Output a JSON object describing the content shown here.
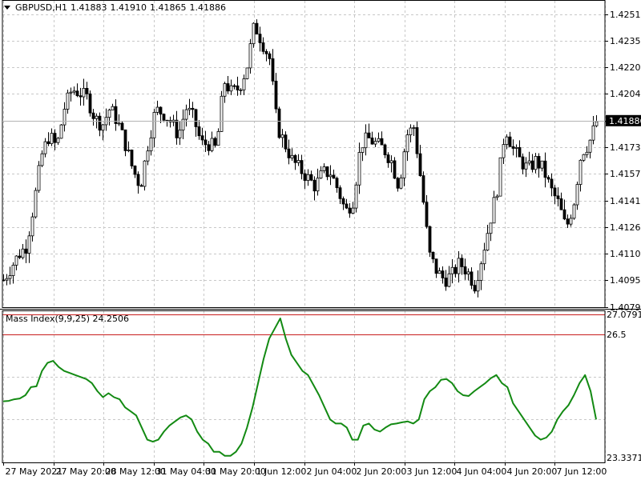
{
  "header": {
    "symbol": "GBPUSD,H1",
    "ohlc": [
      "1.41883",
      "1.41910",
      "1.41865",
      "1.41886"
    ]
  },
  "indicator": {
    "label": "Mass Index(9,9,25) 24.2506"
  },
  "colors": {
    "background": "#ffffff",
    "grid": "#c8c8c8",
    "candle": "#000000",
    "mass_index_line": "#138a13",
    "level_line": "#c81e1e",
    "price_marker": "#000000"
  },
  "chart_data": [
    {
      "type": "candlestick",
      "symbol": "GBPUSD,H1",
      "ylim": [
        1.4079,
        1.4259
      ],
      "y_ticks": [
        "1.42510",
        "1.42355",
        "1.42200",
        "1.42045",
        "1.41885",
        "1.41730",
        "1.41575",
        "1.41415",
        "1.41260",
        "1.41105",
        "1.40950",
        "1.40790"
      ],
      "current_price": "1.41886",
      "x_ticks": [
        "27 May 2021",
        "27 May 20:00",
        "28 May 12:00",
        "31 May 04:00",
        "31 May 20:00",
        "1 Jun 12:00",
        "2 Jun 04:00",
        "2 Jun 20:00",
        "3 Jun 12:00",
        "4 Jun 04:00",
        "4 Jun 20:00",
        "7 Jun 12:00"
      ],
      "close_path": [
        [
          0,
          1.4095
        ],
        [
          2,
          1.411
        ],
        [
          3,
          1.4115
        ],
        [
          4,
          1.414
        ],
        [
          5,
          1.4168
        ],
        [
          6,
          1.418
        ],
        [
          7,
          1.4173
        ],
        [
          8,
          1.4196
        ],
        [
          9,
          1.4207
        ],
        [
          10,
          1.4205
        ],
        [
          11,
          1.4202
        ],
        [
          12,
          1.419
        ],
        [
          13,
          1.4186
        ],
        [
          14,
          1.4196
        ],
        [
          15,
          1.4188
        ],
        [
          16,
          1.4175
        ],
        [
          17,
          1.416
        ],
        [
          18,
          1.415
        ],
        [
          19,
          1.4175
        ],
        [
          20,
          1.4195
        ],
        [
          21,
          1.4193
        ],
        [
          22,
          1.4188
        ],
        [
          23,
          1.418
        ],
        [
          24,
          1.4196
        ],
        [
          25,
          1.419
        ],
        [
          26,
          1.4175
        ],
        [
          27,
          1.4175
        ],
        [
          28,
          1.4172
        ],
        [
          29,
          1.4212
        ],
        [
          30,
          1.4205
        ],
        [
          31,
          1.4208
        ],
        [
          32,
          1.422
        ],
        [
          33,
          1.4245
        ],
        [
          34,
          1.4235
        ],
        [
          35,
          1.4225
        ],
        [
          36,
          1.4185
        ],
        [
          37,
          1.4175
        ],
        [
          38,
          1.4165
        ],
        [
          39,
          1.416
        ],
        [
          40,
          1.4155
        ],
        [
          41,
          1.415
        ],
        [
          42,
          1.4158
        ],
        [
          43,
          1.4158
        ],
        [
          44,
          1.4148
        ],
        [
          45,
          1.4135
        ],
        [
          46,
          1.4142
        ],
        [
          47,
          1.4175
        ],
        [
          48,
          1.4178
        ],
        [
          49,
          1.4175
        ],
        [
          50,
          1.4172
        ],
        [
          51,
          1.4165
        ],
        [
          52,
          1.415
        ],
        [
          53,
          1.418
        ],
        [
          54,
          1.4185
        ],
        [
          55,
          1.415
        ],
        [
          56,
          1.411
        ],
        [
          57,
          1.41
        ],
        [
          58,
          1.4095
        ],
        [
          59,
          1.4098
        ],
        [
          60,
          1.4105
        ],
        [
          61,
          1.41
        ],
        [
          62,
          1.4092
        ],
        [
          63,
          1.411
        ],
        [
          64,
          1.413
        ],
        [
          65,
          1.415
        ],
        [
          66,
          1.4185
        ],
        [
          67,
          1.4172
        ],
        [
          68,
          1.4165
        ],
        [
          69,
          1.416
        ],
        [
          70,
          1.4165
        ],
        [
          71,
          1.416
        ],
        [
          72,
          1.4148
        ],
        [
          73,
          1.414
        ],
        [
          74,
          1.4125
        ],
        [
          75,
          1.414
        ],
        [
          76,
          1.417
        ],
        [
          77,
          1.4175
        ],
        [
          78,
          1.4188
        ]
      ]
    },
    {
      "type": "line",
      "name": "Mass Index(9,9,25) 24.2506",
      "ylim": [
        23.3371,
        27.0791
      ],
      "y_ticks": [
        "27.0791",
        "26.5",
        "23.3371"
      ],
      "levels": [
        27.0,
        26.5
      ],
      "values": [
        24.85,
        24.86,
        24.9,
        24.92,
        25.0,
        25.2,
        25.22,
        25.6,
        25.8,
        25.85,
        25.7,
        25.6,
        25.55,
        25.5,
        25.45,
        25.4,
        25.3,
        25.1,
        24.95,
        25.05,
        24.95,
        24.9,
        24.7,
        24.6,
        24.5,
        24.2,
        23.9,
        23.85,
        23.9,
        24.1,
        24.25,
        24.35,
        24.45,
        24.5,
        24.4,
        24.1,
        23.9,
        23.8,
        23.6,
        23.6,
        23.5,
        23.5,
        23.6,
        23.8,
        24.2,
        24.7,
        25.3,
        25.9,
        26.4,
        26.65,
        26.9,
        26.4,
        26.0,
        25.8,
        25.6,
        25.5,
        25.25,
        25.0,
        24.7,
        24.4,
        24.3,
        24.3,
        24.2,
        23.9,
        23.9,
        24.25,
        24.3,
        24.15,
        24.1,
        24.2,
        24.28,
        24.3,
        24.33,
        24.35,
        24.3,
        24.4,
        24.9,
        25.1,
        25.2,
        25.38,
        25.4,
        25.3,
        25.1,
        25.0,
        24.98,
        25.1,
        25.2,
        25.3,
        25.42,
        25.5,
        25.3,
        25.2,
        24.8,
        24.6,
        24.4,
        24.2,
        24.0,
        23.9,
        23.95,
        24.1,
        24.4,
        24.6,
        24.75,
        25.0,
        25.3,
        25.5,
        25.1,
        24.4
      ]
    }
  ]
}
